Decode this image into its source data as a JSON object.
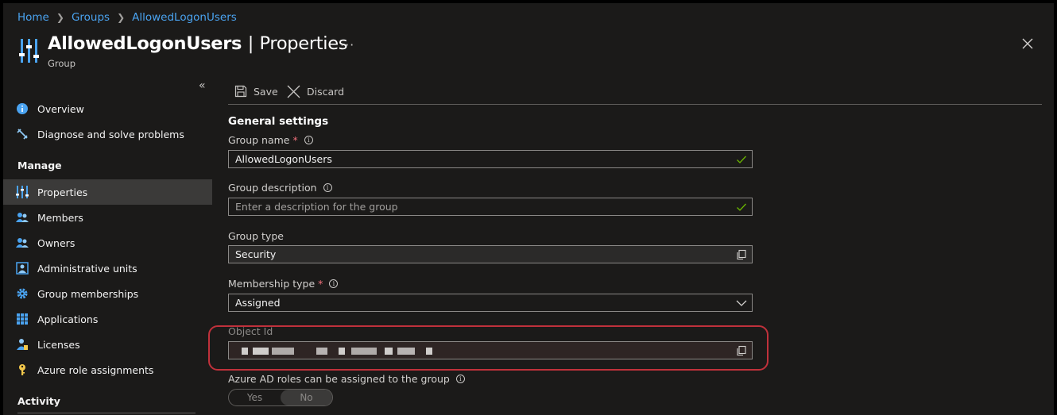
{
  "breadcrumb": {
    "items": [
      "Home",
      "Groups",
      "AllowedLogonUsers"
    ]
  },
  "header": {
    "title_name": "AllowedLogonUsers",
    "title_separator": "|",
    "title_section": "Properties",
    "subtitle": "Group",
    "more": "···"
  },
  "sidebar": {
    "items_top": [
      {
        "label": "Overview",
        "icon": "info-icon"
      },
      {
        "label": "Diagnose and solve problems",
        "icon": "wrench-icon"
      }
    ],
    "manage_header": "Manage",
    "manage_items": [
      {
        "label": "Properties",
        "icon": "properties-icon",
        "active": true
      },
      {
        "label": "Members",
        "icon": "members-icon"
      },
      {
        "label": "Owners",
        "icon": "owners-icon"
      },
      {
        "label": "Administrative units",
        "icon": "admin-units-icon"
      },
      {
        "label": "Group memberships",
        "icon": "gear-icon"
      },
      {
        "label": "Applications",
        "icon": "apps-grid-icon"
      },
      {
        "label": "Licenses",
        "icon": "license-icon"
      },
      {
        "label": "Azure role assignments",
        "icon": "key-icon"
      }
    ],
    "activity_header": "Activity"
  },
  "toolbar": {
    "save_label": "Save",
    "discard_label": "Discard"
  },
  "form": {
    "section_title": "General settings",
    "group_name": {
      "label": "Group name",
      "value": "AllowedLogonUsers"
    },
    "group_description": {
      "label": "Group description",
      "placeholder": "Enter a description for the group"
    },
    "group_type": {
      "label": "Group type",
      "value": "Security"
    },
    "membership_type": {
      "label": "Membership type",
      "value": "Assigned"
    },
    "object_id": {
      "label": "Object Id"
    },
    "azure_ad_roles": {
      "label": "Azure AD roles can be assigned to the group",
      "yes": "Yes",
      "no": "No",
      "selected": "No"
    }
  },
  "colors": {
    "accent": "#4aa3f0",
    "required": "#f1707b",
    "highlight": "#c0313b",
    "valid": "#6bb700"
  }
}
